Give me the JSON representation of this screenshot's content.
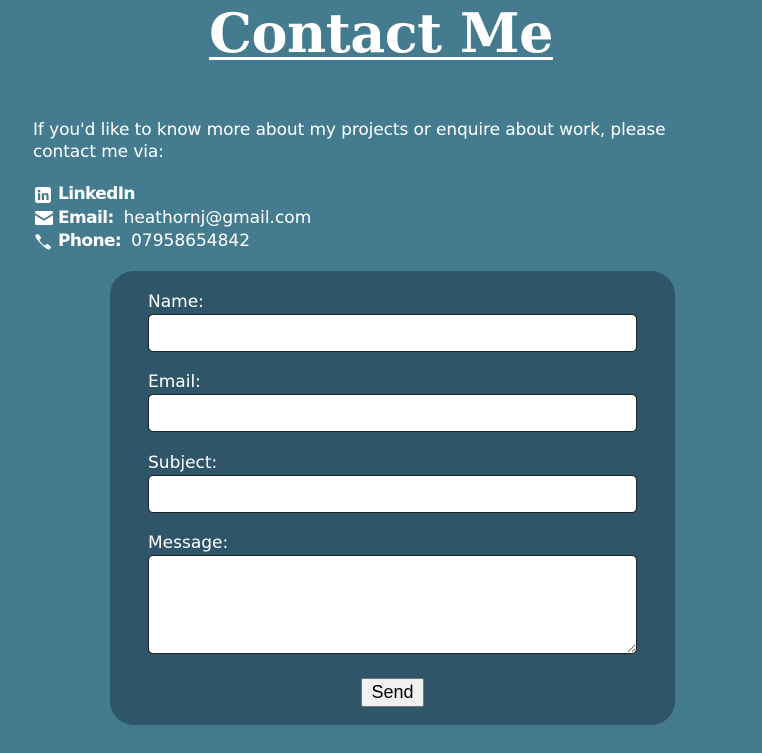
{
  "page": {
    "title": "Contact Me",
    "intro": "If you'd like to know more about my projects or enquire about work, please contact me via:"
  },
  "contacts": {
    "linkedin": {
      "label": "LinkedIn",
      "icon": "linkedin-icon"
    },
    "email": {
      "label": "Email:",
      "value": "heathornj@gmail.com",
      "icon": "envelope-icon"
    },
    "phone": {
      "label": "Phone:",
      "value": "07958654842",
      "icon": "phone-icon"
    }
  },
  "form": {
    "name_label": "Name:",
    "name_value": "",
    "email_label": "Email:",
    "email_value": "",
    "subject_label": "Subject:",
    "subject_value": "",
    "message_label": "Message:",
    "message_value": "",
    "send_label": "Send"
  },
  "colors": {
    "page_background": "#457b8e",
    "form_background": "#2e5568",
    "text": "#ffffff"
  }
}
